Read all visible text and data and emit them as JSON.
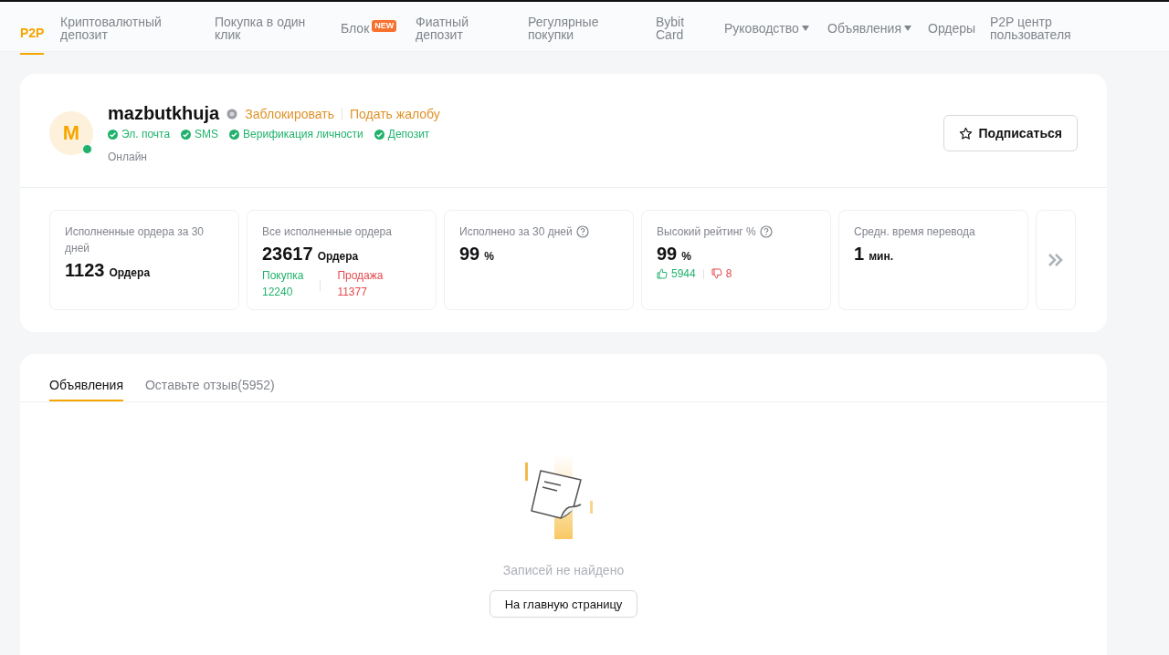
{
  "nav": [
    {
      "label": "P2P",
      "selected": true,
      "kind": "plain"
    },
    {
      "label": "Криптовалютный депозит",
      "selected": false,
      "kind": "plain"
    },
    {
      "label": "Покупка в один клик",
      "selected": false,
      "kind": "plain"
    },
    {
      "label": "Блок",
      "selected": false,
      "kind": "badge",
      "badge": "NEW"
    },
    {
      "label": "Фиатный депозит",
      "selected": false,
      "kind": "plain"
    },
    {
      "label": "Регулярные покупки",
      "selected": false,
      "kind": "plain"
    },
    {
      "label": "Bybit Card",
      "selected": false,
      "kind": "plain"
    },
    {
      "label": "Руководство",
      "selected": false,
      "kind": "dropdown"
    },
    {
      "label": "Объявления",
      "selected": false,
      "kind": "dropdown"
    },
    {
      "label": "Ордеры",
      "selected": false,
      "kind": "plain"
    },
    {
      "label": "P2P центр пользователя",
      "selected": false,
      "kind": "plain"
    }
  ],
  "profile": {
    "avatar_letter": "M",
    "online": true,
    "name": "mazbutkhuja",
    "block_link": "Заблокировать",
    "report_link": "Подать жалобу",
    "verifications": [
      "Эл. почта",
      "SMS",
      "Верификация личности",
      "Депозит"
    ],
    "status": "Онлайн",
    "subscribe_button": "Подписаться"
  },
  "stats": [
    {
      "kind": "plain",
      "title": "Исполненные ордера за 30 дней",
      "help": false,
      "value": "1123",
      "unit": "Ордера"
    },
    {
      "kind": "split",
      "title": "Все исполненные ордера",
      "help": false,
      "value": "23617",
      "unit": "Ордера",
      "buy_label": "Покупка",
      "buy_value": "12240",
      "sell_label": "Продажа",
      "sell_value": "11377"
    },
    {
      "kind": "plain",
      "title": "Исполнено за 30 дней",
      "help": true,
      "value": "99",
      "unit": "%"
    },
    {
      "kind": "votes",
      "title": "Высокий рейтинг %",
      "help": true,
      "value": "99",
      "unit": "%",
      "likes": "5944",
      "dislikes": "8"
    },
    {
      "kind": "plain",
      "title": "Средн. время перевода",
      "help": false,
      "value": "1",
      "unit": "мин."
    }
  ],
  "tabs": [
    {
      "label": "Объявления",
      "selected": true
    },
    {
      "label": "Оставьте отзыв(5952)",
      "selected": false
    }
  ],
  "empty": {
    "message": "Записей не найдено",
    "button": "На главную страницу"
  }
}
